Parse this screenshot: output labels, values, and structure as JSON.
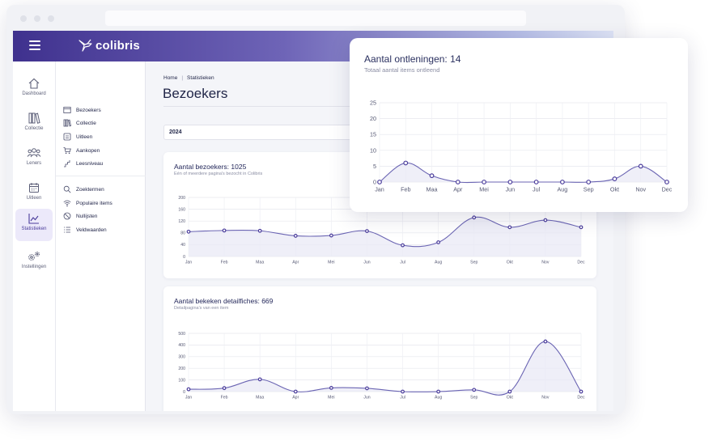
{
  "app": {
    "logo_text": "colibris",
    "colors": {
      "accent": "#4b3d9c",
      "line": "#6b65b3",
      "fill": "#e9e9f6"
    }
  },
  "rail": [
    {
      "label": "Dashboard",
      "icon": "home-icon"
    },
    {
      "label": "Collectie",
      "icon": "books-icon"
    },
    {
      "label": "Leners",
      "icon": "users-icon"
    },
    {
      "label": "Uitleen",
      "icon": "calendar-icon"
    },
    {
      "label": "Statistieken",
      "icon": "chart-icon",
      "active": true
    },
    {
      "label": "Instellingen",
      "icon": "gears-icon"
    }
  ],
  "submenu": {
    "group1": [
      {
        "label": "Bezoekers",
        "icon": "visitors-icon"
      },
      {
        "label": "Collectie",
        "icon": "books-icon"
      },
      {
        "label": "Uitleen",
        "icon": "swap-icon"
      },
      {
        "label": "Aankopen",
        "icon": "cart-icon"
      },
      {
        "label": "Leesniveau",
        "icon": "levels-icon"
      }
    ],
    "group2": [
      {
        "label": "Zoektermen",
        "icon": "search-icon"
      },
      {
        "label": "Populaire items",
        "icon": "wifi-icon"
      },
      {
        "label": "Nullijsten",
        "icon": "block-icon"
      },
      {
        "label": "Veldwaarden",
        "icon": "list-icon"
      }
    ]
  },
  "main": {
    "breadcrumb": {
      "home": "Home",
      "current": "Statistieken"
    },
    "title": "Bezoekers",
    "year": "2024"
  },
  "chart_data": [
    {
      "type": "area",
      "title": "Aantal bezoekers: 1025",
      "subtitle": "Eén of meerdere pagina's bezocht in Colibris",
      "categories": [
        "Jan",
        "Feb",
        "Maa",
        "Apr",
        "Mei",
        "Jun",
        "Jul",
        "Aug",
        "Sep",
        "Okt",
        "Nov",
        "Dec"
      ],
      "values": [
        84,
        88,
        87,
        70,
        71,
        86,
        38,
        48,
        132,
        99,
        123,
        99
      ],
      "ylim": [
        0,
        200
      ],
      "yticks": [
        0,
        40,
        80,
        120,
        160,
        200
      ],
      "grid": true
    },
    {
      "type": "area",
      "title": "Aantal bekeken detailfiches: 669",
      "subtitle": "Detailpagina's van een item",
      "categories": [
        "Jan",
        "Feb",
        "Maa",
        "Apr",
        "Mei",
        "Jun",
        "Jul",
        "Aug",
        "Sep",
        "Okt",
        "Nov",
        "Dec"
      ],
      "values": [
        20,
        30,
        105,
        0,
        32,
        28,
        0,
        0,
        15,
        0,
        430,
        0
      ],
      "ylim": [
        0,
        500
      ],
      "yticks": [
        0,
        100,
        200,
        300,
        400,
        500
      ],
      "grid": true
    },
    {
      "type": "area",
      "title": "Aantal ontleningen: 14",
      "subtitle": "Totaal aantal items ontleend",
      "categories": [
        "Jan",
        "Feb",
        "Maa",
        "Apr",
        "Mei",
        "Jun",
        "Jul",
        "Aug",
        "Sep",
        "Okt",
        "Nov",
        "Dec"
      ],
      "values": [
        0,
        6,
        2,
        0,
        0,
        0,
        0,
        0,
        0,
        1,
        5,
        0
      ],
      "ylim": [
        0,
        25
      ],
      "yticks": [
        0,
        5,
        10,
        15,
        20,
        25
      ],
      "grid": true
    }
  ]
}
